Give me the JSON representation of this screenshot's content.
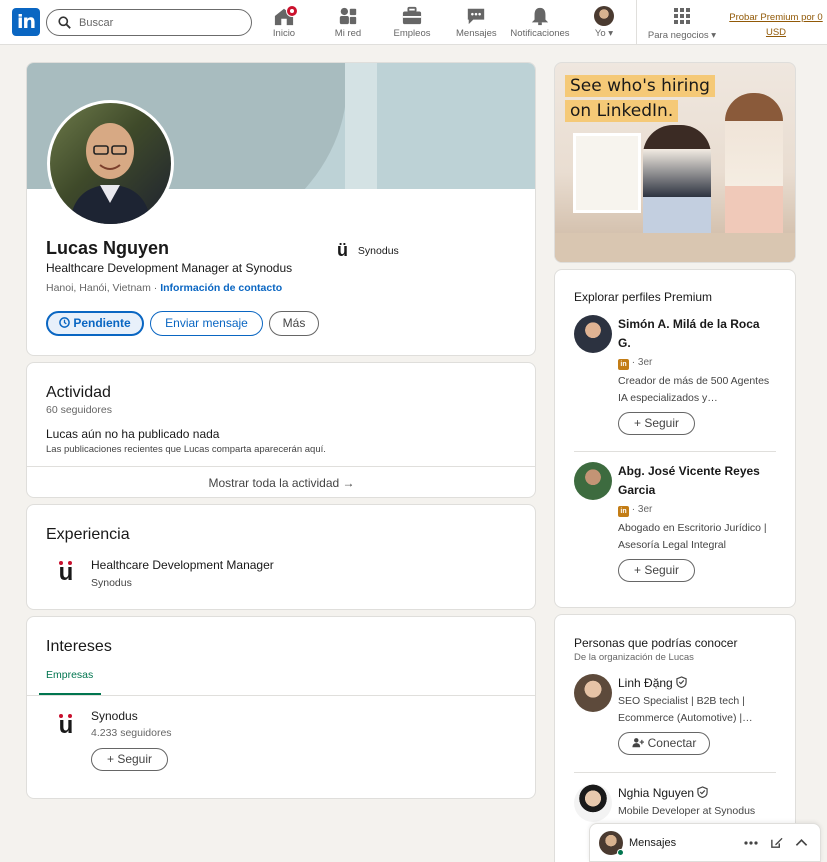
{
  "nav": {
    "logo": "in",
    "search_placeholder": "Buscar",
    "items": [
      {
        "label": "Inicio"
      },
      {
        "label": "Mi red"
      },
      {
        "label": "Empleos"
      },
      {
        "label": "Mensajes"
      },
      {
        "label": "Notificaciones"
      },
      {
        "label": "Yo ▾"
      },
      {
        "label": "Para negocios ▾"
      }
    ],
    "premium": "Probar Premium por 0 USD"
  },
  "profile": {
    "name": "Lucas Nguyen",
    "headline": "Healthcare Development Manager at Synodus",
    "location": "Hanoi, Hanói, Vietnam · ",
    "contact": "Información de contacto",
    "company": "Synodus",
    "btn_pending": "Pendiente",
    "btn_message": "Enviar mensaje",
    "btn_more": "Más"
  },
  "activity": {
    "title": "Actividad",
    "followers": "60 seguidores",
    "empty_title": "Lucas aún no ha publicado nada",
    "empty_sub": "Las publicaciones recientes que Lucas comparta aparecerán aquí.",
    "show_all": "Mostrar toda la actividad →"
  },
  "experience": {
    "title": "Experiencia",
    "role": "Healthcare Development Manager",
    "company": "Synodus"
  },
  "interests": {
    "title": "Intereses",
    "tab": "Empresas",
    "company": "Synodus",
    "followers": "4.233 seguidores",
    "follow": "+ Seguir"
  },
  "ad": {
    "line1": "See who's hiring",
    "line2": "on LinkedIn."
  },
  "premium_profiles": {
    "title": "Explorar perfiles Premium",
    "people": [
      {
        "name": "Simón A. Milá de la Roca G.",
        "degree": "· 3er",
        "desc": "Creador de más de 500 Agentes IA especializados y…",
        "follow": "+ Seguir"
      },
      {
        "name": "Abg. José Vicente Reyes Garcia",
        "degree": "· 3er",
        "desc": "Abogado en Escritorio Jurídico | Asesoría Legal Integral",
        "follow": "+ Seguir"
      }
    ]
  },
  "people_you_may_know": {
    "title": "Personas que podrías conocer",
    "subtitle": "De la organización de Lucas",
    "people": [
      {
        "name": "Linh Đặng",
        "desc": "SEO Specialist | B2B tech | Ecommerce (Automotive) |…",
        "connect": "Conectar"
      },
      {
        "name": "Nghia Nguyen",
        "desc": "Mobile Developer at Synodus"
      }
    ]
  },
  "messaging": {
    "label": "Mensajes"
  }
}
